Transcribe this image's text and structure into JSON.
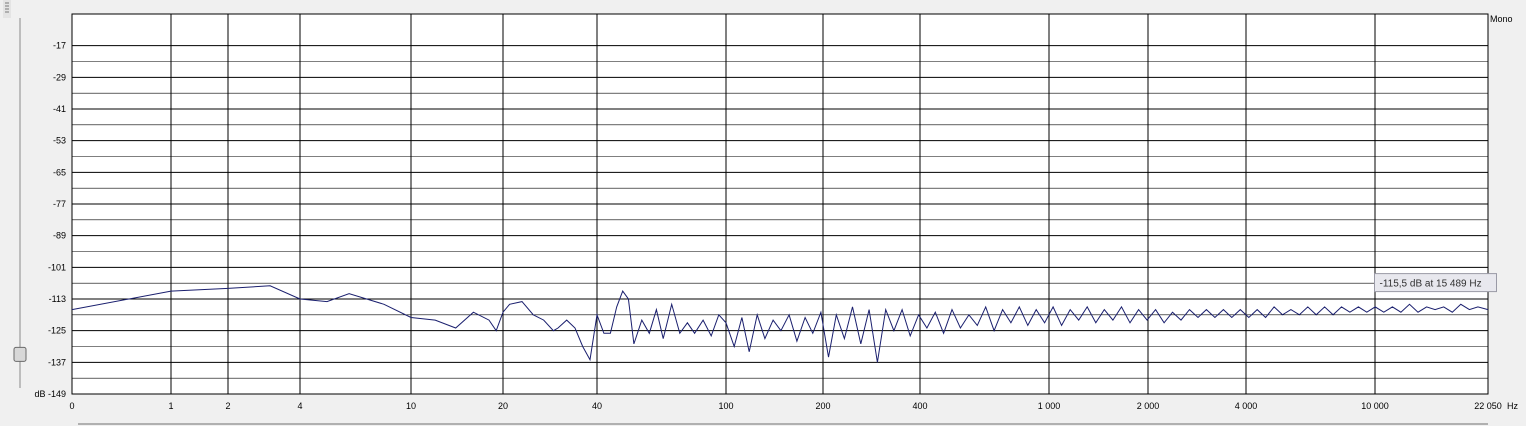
{
  "channel_label": "Mono",
  "tooltip": {
    "text": "-115,5 dB at 15 489 Hz",
    "db": -115.5,
    "hz": 15489
  },
  "gain_slider": {
    "level_db": -134
  },
  "colors": {
    "background": "#f0f0f0",
    "plot": "#ffffff",
    "grid": "#000000",
    "trace": "#1a1f6e",
    "tooltip_bg": "#e8e8ee"
  },
  "chart_data": {
    "type": "line",
    "title": "",
    "xlabel": "Hz",
    "ylabel": "dB",
    "x_scale": "log",
    "xlim": [
      0,
      22050
    ],
    "ylim": [
      -149,
      -5
    ],
    "grid": true,
    "y_ticks": [
      -17,
      -29,
      -41,
      -53,
      -65,
      -77,
      -89,
      -101,
      -113,
      -125,
      -137,
      -149
    ],
    "y_tick_labels": [
      "-17",
      "-29",
      "-41",
      "-53",
      "-65",
      "-77",
      "-89",
      "-101",
      "-113",
      "-125",
      "-137",
      "dB -149"
    ],
    "x_ticks": [
      0,
      1,
      2,
      4,
      10,
      20,
      40,
      100,
      200,
      400,
      1000,
      2000,
      4000,
      10000,
      22050
    ],
    "x_tick_labels": [
      "0",
      "1",
      "2",
      "4",
      "10",
      "20",
      "40",
      "100",
      "200",
      "400",
      "1 000",
      "2 000",
      "4 000",
      "10 000",
      "22 050"
    ],
    "series": [
      {
        "values": [
          [
            0,
            -117
          ],
          [
            1,
            -110
          ],
          [
            2,
            -109
          ],
          [
            3,
            -108
          ],
          [
            4,
            -113
          ],
          [
            5,
            -114
          ],
          [
            6,
            -111
          ],
          [
            8,
            -115
          ],
          [
            10,
            -120
          ],
          [
            12,
            -121
          ],
          [
            14,
            -124
          ],
          [
            16,
            -118
          ],
          [
            18,
            -121
          ],
          [
            19,
            -125
          ],
          [
            20,
            -118
          ],
          [
            21,
            -115
          ],
          [
            23,
            -114
          ],
          [
            25,
            -119
          ],
          [
            27,
            -121
          ],
          [
            29,
            -125
          ],
          [
            30,
            -124
          ],
          [
            32,
            -121
          ],
          [
            34,
            -124
          ],
          [
            36,
            -131
          ],
          [
            38,
            -136
          ],
          [
            40,
            -119
          ],
          [
            42,
            -126
          ],
          [
            44,
            -126
          ],
          [
            46,
            -116
          ],
          [
            48,
            -110
          ],
          [
            50,
            -113
          ],
          [
            52,
            -130
          ],
          [
            55,
            -121
          ],
          [
            58,
            -126
          ],
          [
            61,
            -117
          ],
          [
            64,
            -128
          ],
          [
            68,
            -115
          ],
          [
            72,
            -126
          ],
          [
            76,
            -122
          ],
          [
            80,
            -126
          ],
          [
            85,
            -121
          ],
          [
            90,
            -127
          ],
          [
            95,
            -119
          ],
          [
            100,
            -122
          ],
          [
            106,
            -131
          ],
          [
            112,
            -120
          ],
          [
            118,
            -133
          ],
          [
            125,
            -119
          ],
          [
            132,
            -128
          ],
          [
            140,
            -121
          ],
          [
            148,
            -125
          ],
          [
            157,
            -119
          ],
          [
            166,
            -129
          ],
          [
            176,
            -120
          ],
          [
            186,
            -126
          ],
          [
            197,
            -118
          ],
          [
            208,
            -135
          ],
          [
            220,
            -119
          ],
          [
            233,
            -128
          ],
          [
            247,
            -116
          ],
          [
            262,
            -130
          ],
          [
            278,
            -117
          ],
          [
            295,
            -137
          ],
          [
            313,
            -117
          ],
          [
            332,
            -125
          ],
          [
            352,
            -117
          ],
          [
            373,
            -127
          ],
          [
            396,
            -119
          ],
          [
            420,
            -124
          ],
          [
            446,
            -118
          ],
          [
            473,
            -126
          ],
          [
            502,
            -117
          ],
          [
            533,
            -124
          ],
          [
            566,
            -119
          ],
          [
            601,
            -123
          ],
          [
            638,
            -116
          ],
          [
            677,
            -125
          ],
          [
            719,
            -117
          ],
          [
            763,
            -122
          ],
          [
            810,
            -116
          ],
          [
            860,
            -123
          ],
          [
            913,
            -117
          ],
          [
            969,
            -122
          ],
          [
            1029,
            -116
          ],
          [
            1092,
            -123
          ],
          [
            1160,
            -117
          ],
          [
            1231,
            -121
          ],
          [
            1307,
            -116
          ],
          [
            1388,
            -122
          ],
          [
            1473,
            -117
          ],
          [
            1564,
            -121
          ],
          [
            1661,
            -116
          ],
          [
            1763,
            -122
          ],
          [
            1872,
            -117
          ],
          [
            1988,
            -121
          ],
          [
            2110,
            -117
          ],
          [
            2241,
            -122
          ],
          [
            2379,
            -118
          ],
          [
            2526,
            -121
          ],
          [
            2682,
            -117
          ],
          [
            2848,
            -120
          ],
          [
            3023,
            -117
          ],
          [
            3210,
            -120
          ],
          [
            3408,
            -117
          ],
          [
            3618,
            -120
          ],
          [
            3842,
            -117
          ],
          [
            4079,
            -120
          ],
          [
            4331,
            -117
          ],
          [
            4598,
            -120
          ],
          [
            4882,
            -116
          ],
          [
            5183,
            -119
          ],
          [
            5503,
            -117
          ],
          [
            5843,
            -119
          ],
          [
            6203,
            -116
          ],
          [
            6586,
            -119
          ],
          [
            6993,
            -116
          ],
          [
            7424,
            -119
          ],
          [
            7883,
            -116
          ],
          [
            8369,
            -118
          ],
          [
            8886,
            -116
          ],
          [
            9434,
            -118
          ],
          [
            10017,
            -116
          ],
          [
            10635,
            -118
          ],
          [
            11291,
            -116
          ],
          [
            11988,
            -118
          ],
          [
            12728,
            -115
          ],
          [
            13514,
            -118
          ],
          [
            14348,
            -116
          ],
          [
            15233,
            -117
          ],
          [
            16173,
            -116
          ],
          [
            17172,
            -118
          ],
          [
            18232,
            -115
          ],
          [
            19357,
            -117
          ],
          [
            20552,
            -116
          ],
          [
            22050,
            -117
          ]
        ]
      }
    ]
  }
}
